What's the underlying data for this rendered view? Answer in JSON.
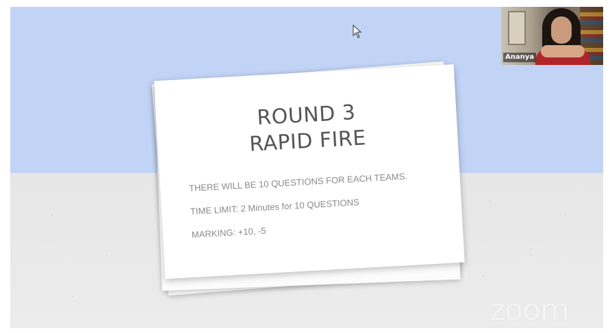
{
  "participant": {
    "name": "Ananya"
  },
  "slide": {
    "title_line1": "ROUND 3",
    "title_line2": "RAPID FIRE",
    "line1": "THERE WILL BE 10 QUESTIONS FOR EACH TEAMS.",
    "line2": "TIME LIMIT: 2 Minutes for 10 QUESTIONS",
    "line3": "MARKING: +10, -5"
  },
  "watermark": {
    "text": "zoom"
  },
  "colors": {
    "sky": "#c2d4f6",
    "floor": "#e8e8e8",
    "card": "#ffffff",
    "title_text": "#555555",
    "body_text": "#8a8a8a"
  }
}
